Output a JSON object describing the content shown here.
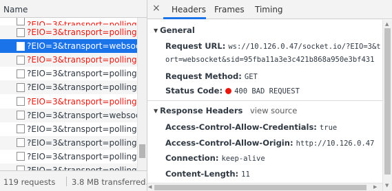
{
  "list": {
    "header": "Name",
    "rows": [
      {
        "label": "?EIO=3&transport=polling&t...",
        "status": "error"
      },
      {
        "label": "?EIO=3&transport=polling&t...",
        "status": "error"
      },
      {
        "label": "?EIO=3&transport=websocket...",
        "status": "selected"
      },
      {
        "label": "?EIO=3&transport=polling&t...",
        "status": "error"
      },
      {
        "label": "?EIO=3&transport=polling&t...",
        "status": "ok"
      },
      {
        "label": "?EIO=3&transport=polling&t...",
        "status": "ok"
      },
      {
        "label": "?EIO=3&transport=polling&t...",
        "status": "error"
      },
      {
        "label": "?EIO=3&transport=websocket...",
        "status": "ok"
      },
      {
        "label": "?EIO=3&transport=polling&t...",
        "status": "ok"
      },
      {
        "label": "?EIO=3&transport=polling&t...",
        "status": "ok"
      },
      {
        "label": "?EIO=3&transport=polling&t...",
        "status": "ok"
      },
      {
        "label": "?EIO=3&transport=polling&t...",
        "status": "ok"
      }
    ]
  },
  "status_bar": {
    "requests": "119 requests",
    "transferred": "3.8 MB transferred..."
  },
  "tabs": {
    "close": "×",
    "headers": "Headers",
    "frames": "Frames",
    "timing": "Timing"
  },
  "general": {
    "title": "General",
    "request_url_key": "Request URL:",
    "request_url_line1": "ws://10.126.0.47/socket.io/?EIO=3&t",
    "request_url_line2": "ort=websocket&sid=95fba11a3e3c421b868a950e3bf431",
    "request_method_key": "Request Method:",
    "request_method_val": "GET",
    "status_code_key": "Status Code:",
    "status_code_val": "400 BAD REQUEST"
  },
  "response_headers": {
    "title": "Response Headers",
    "view_source": "view source",
    "items": [
      {
        "key": "Access-Control-Allow-Credentials:",
        "value": "true"
      },
      {
        "key": "Access-Control-Allow-Origin:",
        "value": "http://10.126.0.47"
      },
      {
        "key": "Connection:",
        "value": "keep-alive"
      },
      {
        "key": "Content-Length:",
        "value": "11"
      }
    ]
  },
  "colors": {
    "accent": "#1a73e8",
    "error": "#e6180f",
    "text": "#303942"
  }
}
